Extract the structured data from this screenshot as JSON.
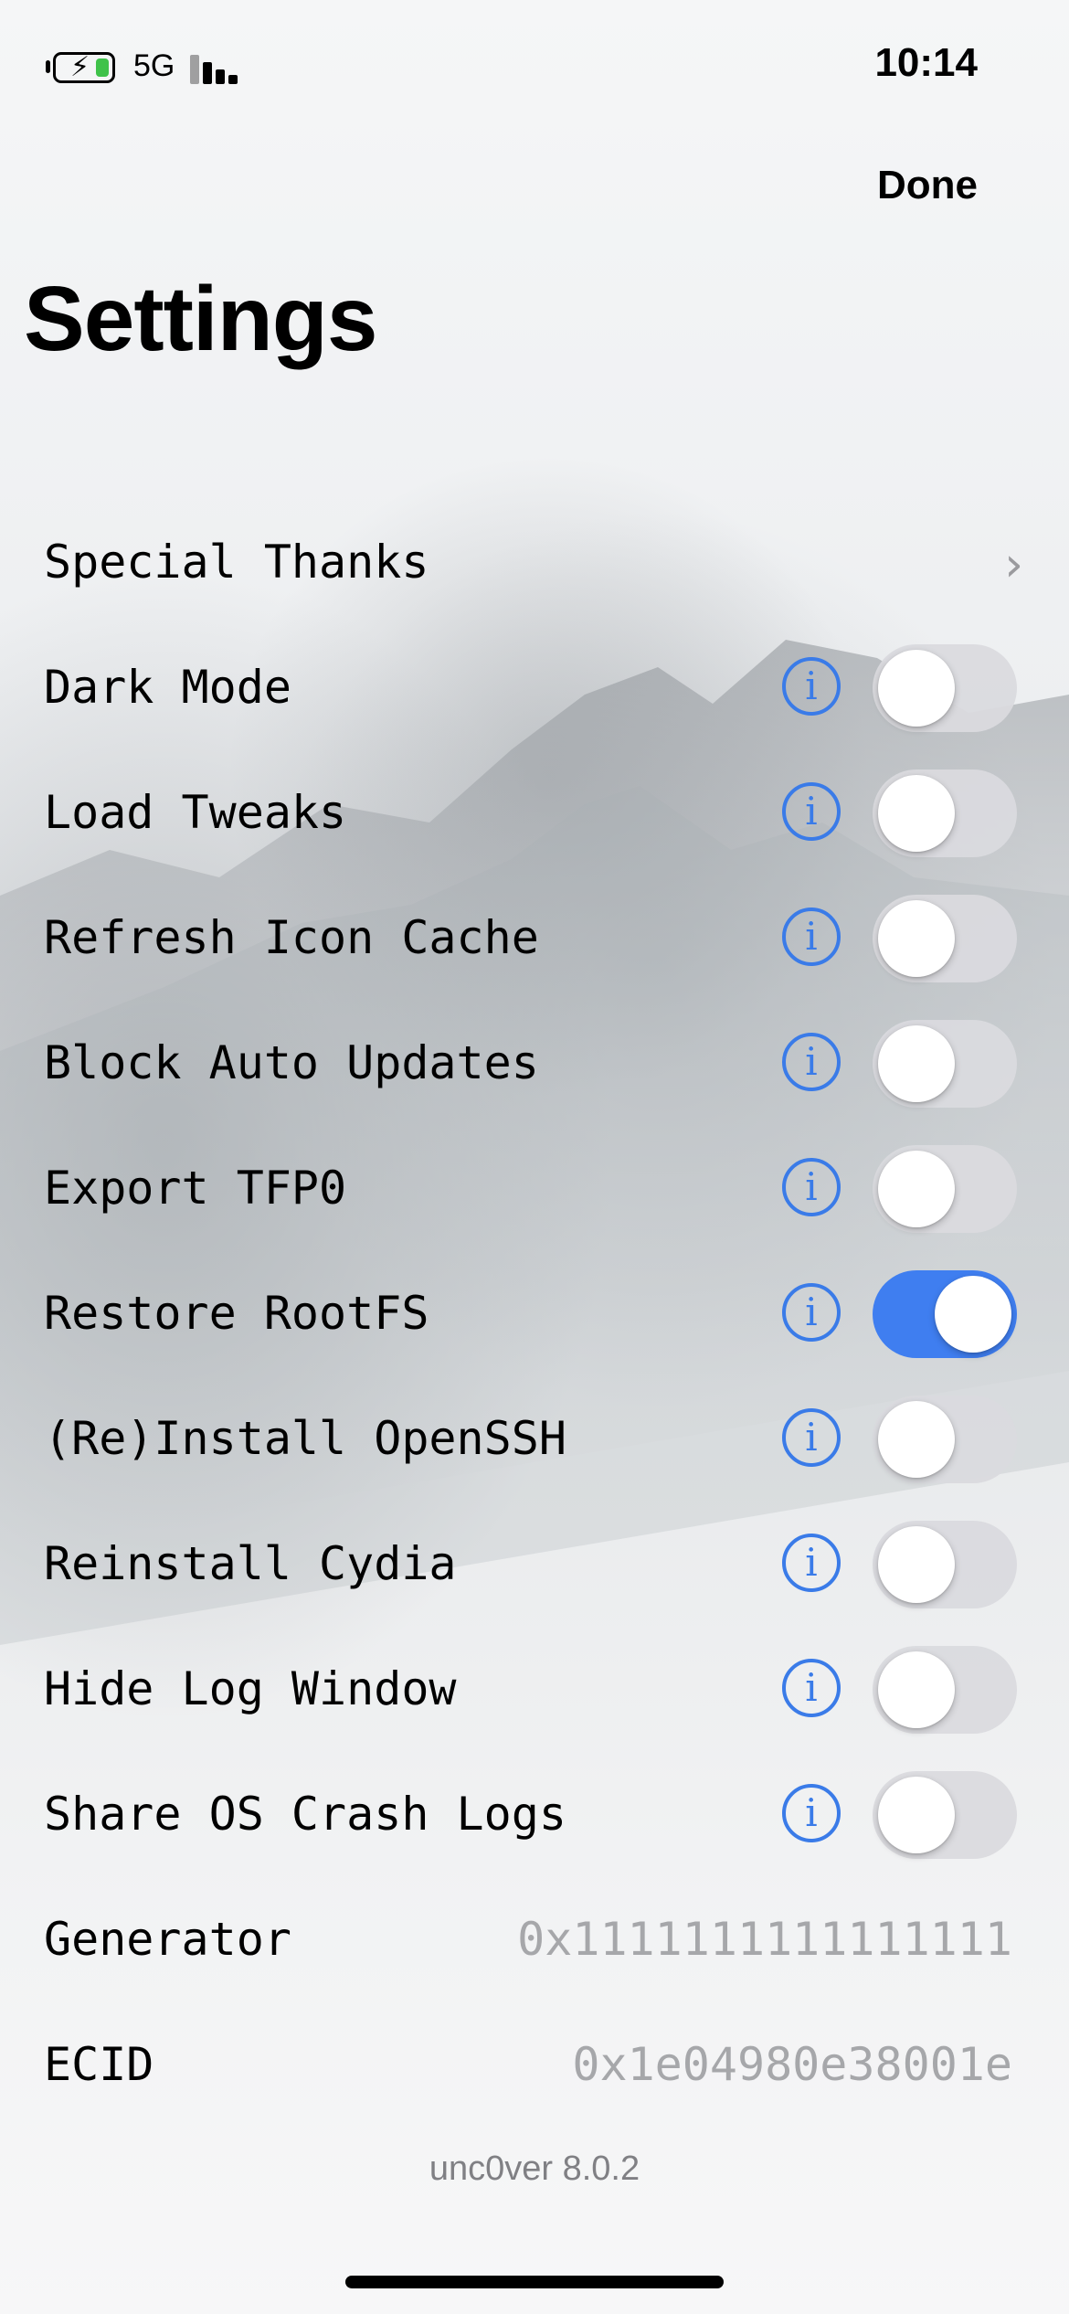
{
  "status_bar": {
    "network": "5G",
    "time": "10:14",
    "battery_icon": "battery-charging-icon",
    "signal_icon": "signal-bars-icon"
  },
  "header": {
    "done_label": "Done",
    "title": "Settings"
  },
  "accent_color": "#3f7ef0",
  "rows": [
    {
      "label": "Special Thanks",
      "kind": "link"
    },
    {
      "label": "Dark Mode",
      "kind": "toggle",
      "on": false
    },
    {
      "label": "Load Tweaks",
      "kind": "toggle",
      "on": false
    },
    {
      "label": "Refresh Icon Cache",
      "kind": "toggle",
      "on": false
    },
    {
      "label": "Block Auto Updates",
      "kind": "toggle",
      "on": false
    },
    {
      "label": "Export TFP0",
      "kind": "toggle",
      "on": false
    },
    {
      "label": "Restore RootFS",
      "kind": "toggle",
      "on": true
    },
    {
      "label": "(Re)Install OpenSSH",
      "kind": "toggle",
      "on": false
    },
    {
      "label": "Reinstall Cydia",
      "kind": "toggle",
      "on": false
    },
    {
      "label": "Hide Log Window",
      "kind": "toggle",
      "on": false
    },
    {
      "label": "Share OS Crash Logs",
      "kind": "toggle",
      "on": false
    },
    {
      "label": "Generator",
      "kind": "value",
      "value": "0x1111111111111111"
    },
    {
      "label": "ECID",
      "kind": "value",
      "value": "0x1e04980e38001e"
    }
  ],
  "footer": {
    "version": "unc0ver 8.0.2"
  }
}
